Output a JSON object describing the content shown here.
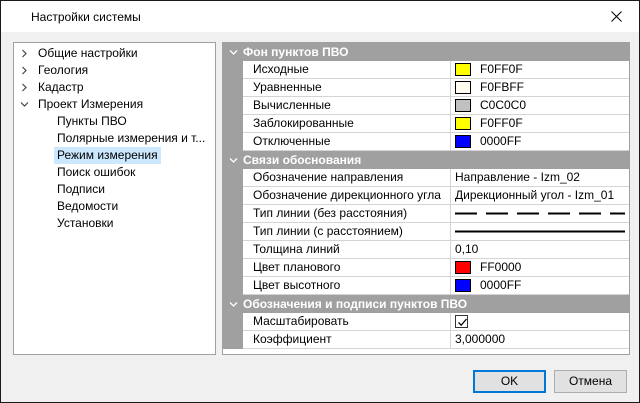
{
  "window": {
    "title": "Настройки системы"
  },
  "tree": [
    {
      "label": "Общие настройки",
      "level": 0,
      "expander": "right"
    },
    {
      "label": "Геология",
      "level": 0,
      "expander": "right"
    },
    {
      "label": "Кадастр",
      "level": 0,
      "expander": "right"
    },
    {
      "label": "Проект Измерения",
      "level": 0,
      "expander": "down"
    },
    {
      "label": "Пункты ПВО",
      "level": 1
    },
    {
      "label": "Полярные измерения и т...",
      "level": 1
    },
    {
      "label": "Режим измерения",
      "level": 1,
      "selected": true
    },
    {
      "label": "Поиск ошибок",
      "level": 1
    },
    {
      "label": "Подписи",
      "level": 1
    },
    {
      "label": "Ведомости",
      "level": 1
    },
    {
      "label": "Установки",
      "level": 1
    }
  ],
  "grid": {
    "categories": [
      {
        "title": "Фон пунктов ПВО",
        "props": [
          {
            "name": "Исходные",
            "type": "color",
            "color": "#FFFF00",
            "value": "F0FF0F"
          },
          {
            "name": "Уравненные",
            "type": "color",
            "color": "#FFFBF0",
            "value": "F0FBFF"
          },
          {
            "name": "Вычисленные",
            "type": "color",
            "color": "#C0C0C0",
            "value": "C0C0C0"
          },
          {
            "name": "Заблокированные",
            "type": "color",
            "color": "#FFFF00",
            "value": "F0FF0F"
          },
          {
            "name": "Отключенные",
            "type": "color",
            "color": "#0000FF",
            "value": "0000FF"
          }
        ]
      },
      {
        "title": "Связи обоснования",
        "props": [
          {
            "name": "Обозначение направления",
            "type": "text",
            "value": "Направление - Izm_02"
          },
          {
            "name": "Обозначение дирекционного угла",
            "type": "text",
            "value": "Дирекционный угол - Izm_01"
          },
          {
            "name": "Тип линии (без расстояния)",
            "type": "line",
            "style": "dashed"
          },
          {
            "name": "Тип линии (с расстоянием)",
            "type": "line",
            "style": "solid"
          },
          {
            "name": "Толщина линий",
            "type": "text",
            "value": "0,10"
          },
          {
            "name": "Цвет планового",
            "type": "color",
            "color": "#FF0000",
            "value": "FF0000"
          },
          {
            "name": "Цвет высотного",
            "type": "color",
            "color": "#0000FF",
            "value": "0000FF"
          }
        ]
      },
      {
        "title": "Обозначения и подписи пунктов ПВО",
        "props": [
          {
            "name": "Масштабировать",
            "type": "checkbox",
            "checked": true
          },
          {
            "name": "Коэффициент",
            "type": "text",
            "value": "3,000000"
          }
        ]
      }
    ]
  },
  "buttons": {
    "ok": "OK",
    "cancel": "Отмена"
  }
}
